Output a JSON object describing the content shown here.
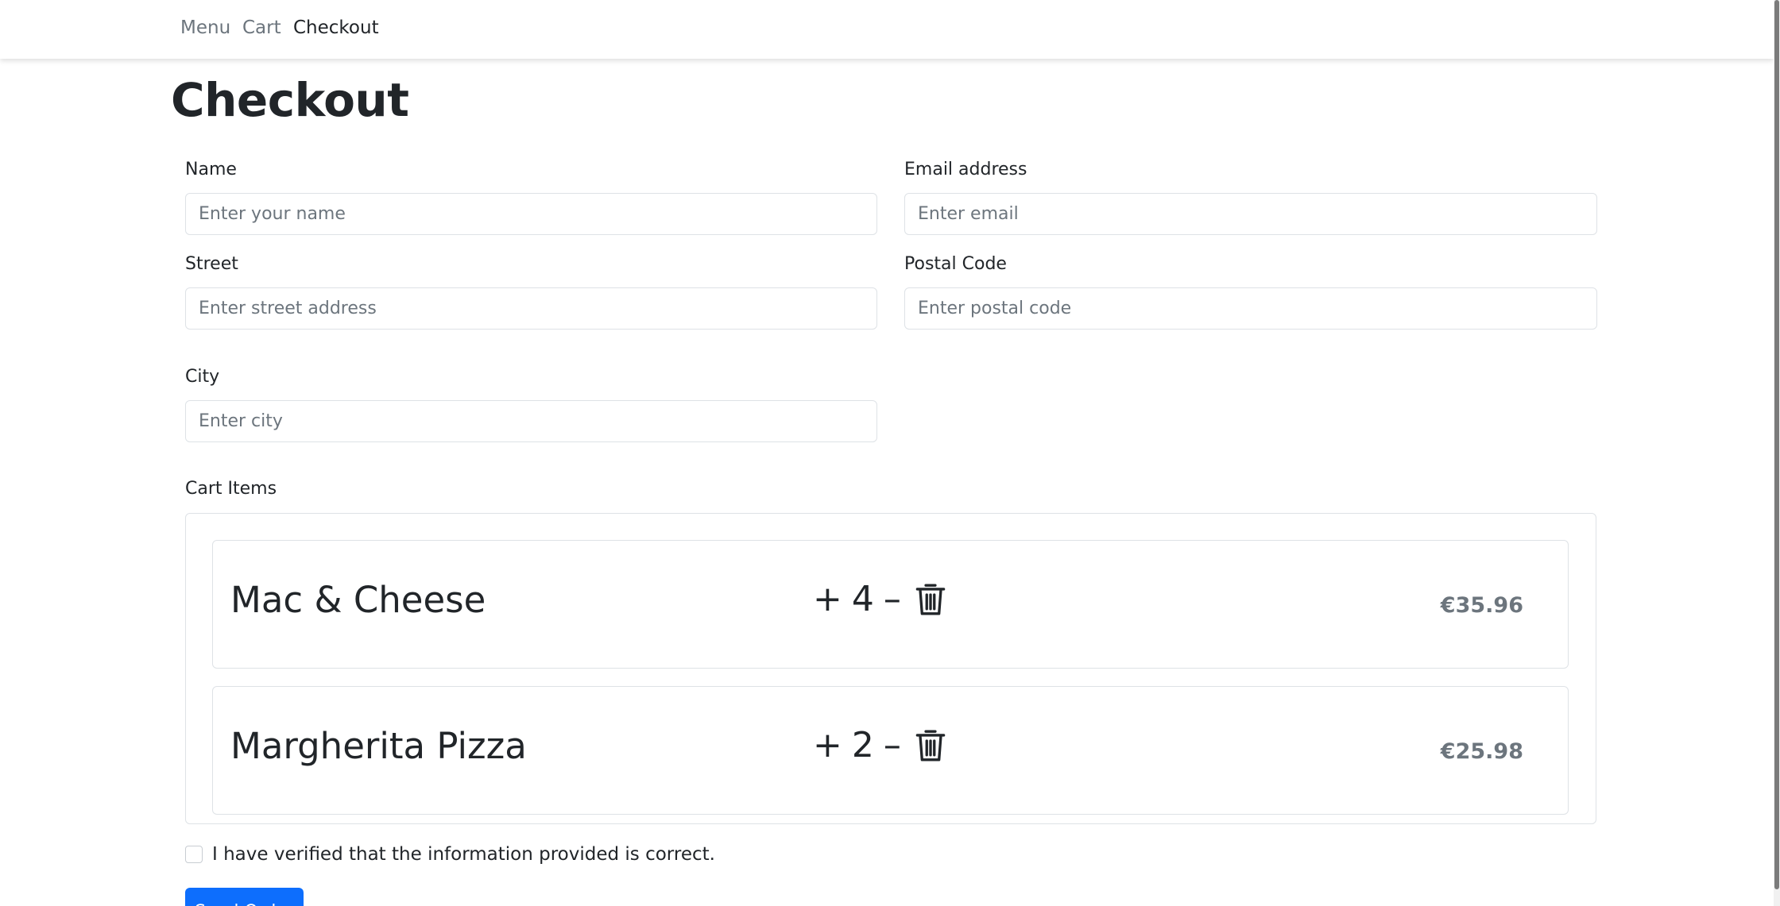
{
  "nav": {
    "items": [
      {
        "label": "Menu",
        "active": false
      },
      {
        "label": "Cart",
        "active": false
      },
      {
        "label": "Checkout",
        "active": true
      }
    ]
  },
  "page": {
    "title": "Checkout"
  },
  "form": {
    "name": {
      "label": "Name",
      "value": "",
      "placeholder": "Enter your name"
    },
    "email": {
      "label": "Email address",
      "value": "",
      "placeholder": "Enter email"
    },
    "street": {
      "label": "Street",
      "value": "",
      "placeholder": "Enter street address"
    },
    "postal": {
      "label": "Postal Code",
      "value": "",
      "placeholder": "Enter postal code"
    },
    "city": {
      "label": "City",
      "value": "",
      "placeholder": "Enter city"
    }
  },
  "cart": {
    "label": "Cart Items",
    "items": [
      {
        "name": "Mac & Cheese",
        "quantity": "4",
        "price": "€35.96",
        "plus_icon": "plus-icon",
        "minus_icon": "minus-icon",
        "delete_icon": "trash-icon"
      },
      {
        "name": "Margherita Pizza",
        "quantity": "2",
        "price": "€25.98",
        "plus_icon": "plus-icon",
        "minus_icon": "minus-icon",
        "delete_icon": "trash-icon"
      }
    ]
  },
  "verify": {
    "label": "I have verified that the information provided is correct.",
    "checked": false
  },
  "actions": {
    "send_label": "Send Order"
  },
  "colors": {
    "primary": "#0d6efd",
    "muted": "#6c757d",
    "text": "#212529",
    "border": "#dee2e6"
  }
}
